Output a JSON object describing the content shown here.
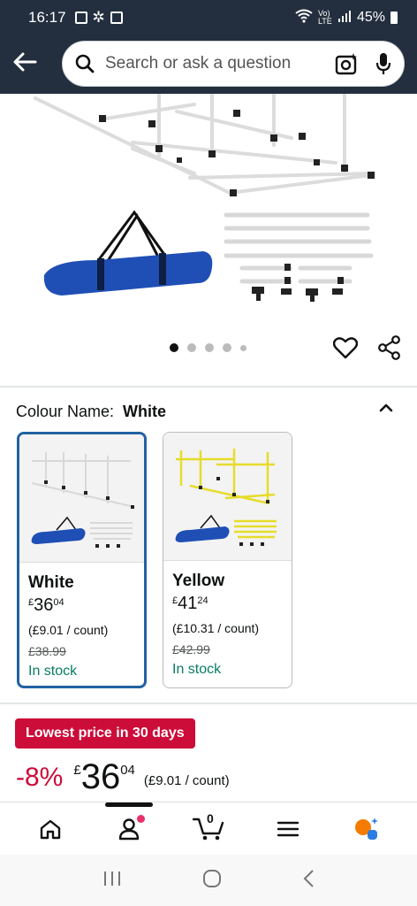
{
  "status": {
    "time": "16:17",
    "network": "Vo) LTE",
    "battery": "45%"
  },
  "search": {
    "placeholder": "Search or ask a question"
  },
  "gallery": {
    "dots_total": 5,
    "dots_active": 0
  },
  "colour": {
    "label": "Colour Name:",
    "selected": "White"
  },
  "variants": [
    {
      "name": "White",
      "price_whole": "36",
      "price_frac": "04",
      "currency": "£",
      "per_unit": "(£9.01 / count)",
      "was": "£38.99",
      "stock": "In stock",
      "selected": true
    },
    {
      "name": "Yellow",
      "price_whole": "41",
      "price_frac": "24",
      "currency": "£",
      "per_unit": "(£10.31 / count)",
      "was": "£42.99",
      "stock": "In stock",
      "selected": false
    }
  ],
  "deal": {
    "badge": "Lowest price in 30 days",
    "discount": "-8%",
    "currency": "£",
    "price_whole": "36",
    "price_frac": "04",
    "per_unit": "(£9.01 / count)"
  },
  "nav": {
    "cart_count": "0"
  },
  "colors": {
    "header_bg": "#232f3e",
    "deal_red": "#cc0c39",
    "stock_green": "#067d62",
    "selected_border": "#2162a1"
  }
}
